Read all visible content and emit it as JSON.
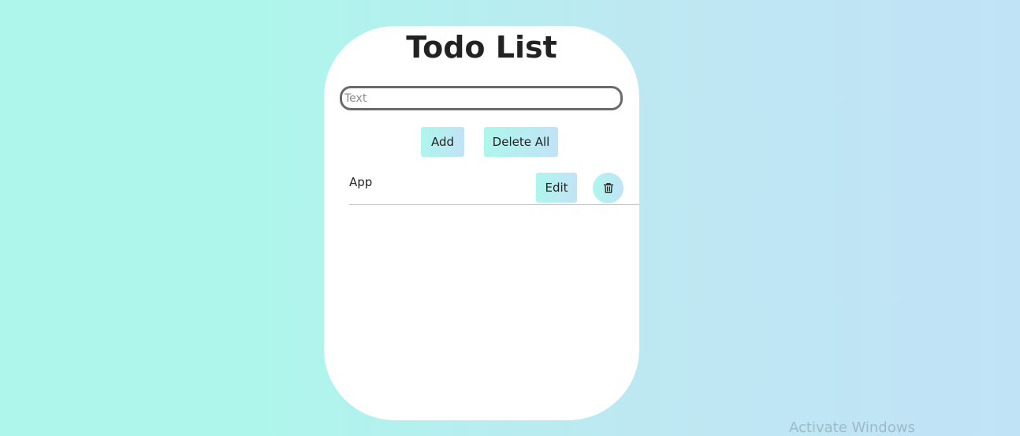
{
  "app": {
    "title": "Todo List"
  },
  "input": {
    "placeholder": "Text",
    "value": ""
  },
  "actions": {
    "add_label": "Add",
    "delete_all_label": "Delete All"
  },
  "todos": [
    {
      "text": "App",
      "edit_label": "Edit",
      "delete_icon": "trash-icon"
    }
  ],
  "watermark": {
    "text": "Activate Windows"
  },
  "colors": {
    "background_left": "#aef6ec",
    "background_right": "#c1e3f6",
    "card": "#ffffff",
    "button_gradient_start": "#aef6ec",
    "button_gradient_end": "#c1e3f6",
    "input_border": "#6a6a6a",
    "text": "#222222"
  }
}
